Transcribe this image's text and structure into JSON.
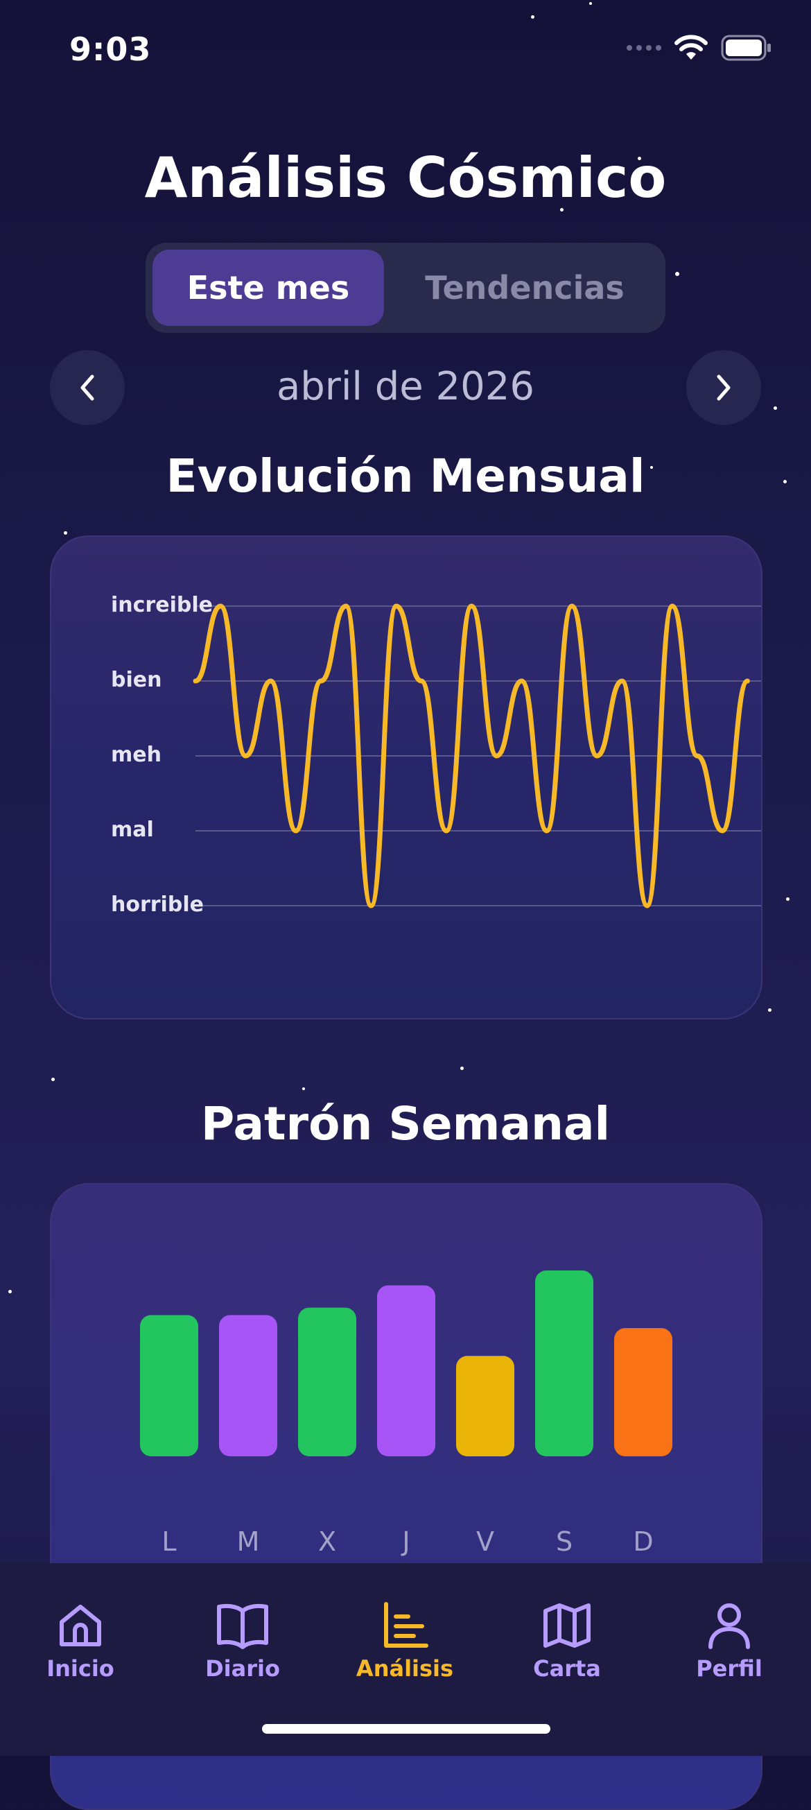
{
  "status": {
    "time": "9:03"
  },
  "header": {
    "title": "Análisis Cósmico"
  },
  "segments": {
    "active": "Este mes",
    "inactive": "Tendencias"
  },
  "month_selector": {
    "label": "abril de 2026"
  },
  "monthly": {
    "title": "Evolución Mensual",
    "levels": [
      "increible",
      "bien",
      "meh",
      "mal",
      "horrible"
    ]
  },
  "weekly": {
    "title": "Patrón Semanal",
    "days": [
      "L",
      "M",
      "X",
      "J",
      "V",
      "S",
      "D"
    ]
  },
  "chart_data": [
    {
      "type": "line",
      "title": "Evolución Mensual",
      "y_categories": [
        "horrible",
        "mal",
        "meh",
        "bien",
        "increible"
      ],
      "y_values_note": "",
      "values": [
        4,
        5,
        3,
        4,
        2,
        4,
        5,
        1,
        5,
        4,
        2,
        5,
        3,
        4,
        2,
        5,
        3,
        4,
        1,
        5,
        3,
        2,
        4
      ],
      "color": "#f7b928",
      "grid": true
    },
    {
      "type": "bar",
      "title": "Patrón Semanal",
      "categories": [
        "L",
        "M",
        "X",
        "J",
        "V",
        "S",
        "D"
      ],
      "values": [
        0.76,
        0.76,
        0.8,
        0.92,
        0.54,
        1.0,
        0.69
      ],
      "colors": [
        "#22c55e",
        "#a855f7",
        "#22c55e",
        "#a855f7",
        "#eab308",
        "#22c55e",
        "#f97316"
      ]
    }
  ],
  "bottom_nav": {
    "items": [
      {
        "label": "Inicio",
        "icon": "home-icon"
      },
      {
        "label": "Diario",
        "icon": "book-icon"
      },
      {
        "label": "Análisis",
        "icon": "chart-icon"
      },
      {
        "label": "Carta",
        "icon": "map-icon"
      },
      {
        "label": "Perfil",
        "icon": "user-icon"
      }
    ],
    "active_color": "#f7b928",
    "inactive_color": "#b79cff"
  }
}
